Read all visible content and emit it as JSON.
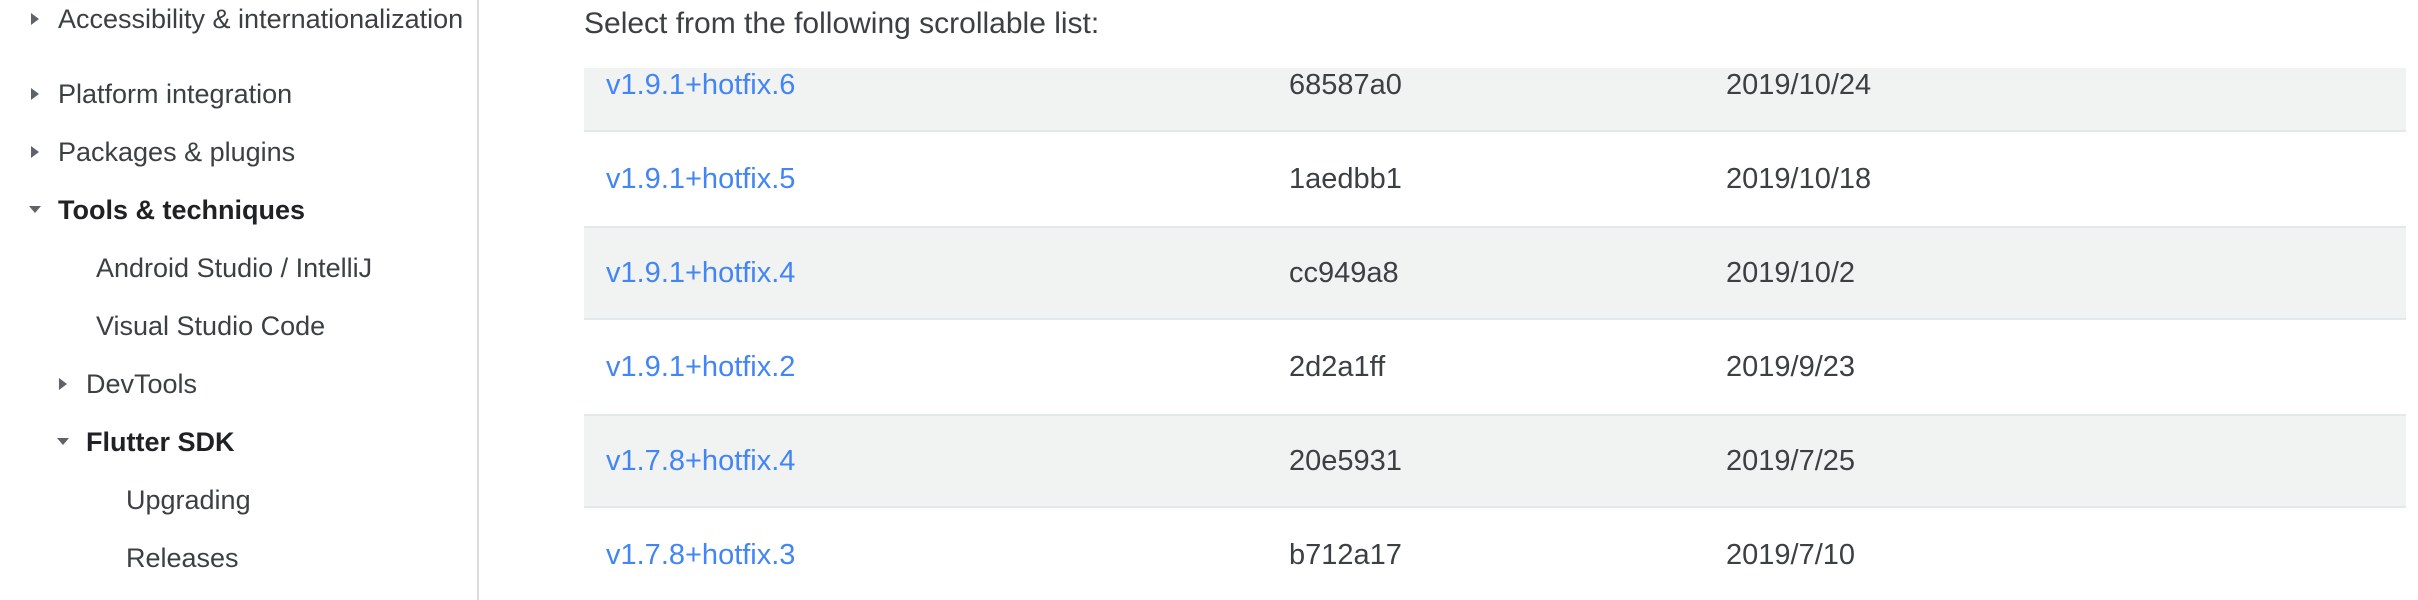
{
  "colors": {
    "link": "#4285f4",
    "text": "#3c4043",
    "heading": "#202124",
    "row_alt_bg": "#f1f2f2",
    "row_border": "#e3e8ea",
    "sidebar_divider": "#dcdcdc"
  },
  "sidebar": {
    "items": [
      {
        "label": "Accessibility & internationalization",
        "level": 1,
        "caret": "collapsed",
        "bold": false,
        "tall": true
      },
      {
        "label": "Platform integration",
        "level": 1,
        "caret": "collapsed",
        "bold": false,
        "tall": false
      },
      {
        "label": "Packages & plugins",
        "level": 1,
        "caret": "collapsed",
        "bold": false,
        "tall": false
      },
      {
        "label": "Tools & techniques",
        "level": 1,
        "caret": "expanded",
        "bold": true,
        "tall": false
      },
      {
        "label": "Android Studio / IntelliJ",
        "level": 2,
        "caret": "none",
        "bold": false,
        "tall": false
      },
      {
        "label": "Visual Studio Code",
        "level": 2,
        "caret": "none",
        "bold": false,
        "tall": false
      },
      {
        "label": "DevTools",
        "level": 2,
        "caret": "collapsed",
        "bold": false,
        "tall": false
      },
      {
        "label": "Flutter SDK",
        "level": 2,
        "caret": "expanded",
        "bold": true,
        "tall": false
      },
      {
        "label": "Upgrading",
        "level": 3,
        "caret": "none",
        "bold": false,
        "tall": false
      },
      {
        "label": "Releases",
        "level": 3,
        "caret": "none",
        "bold": false,
        "tall": false
      }
    ]
  },
  "main": {
    "intro_text": "Select from the following scrollable list:",
    "releases": [
      {
        "version": "v1.9.1+hotfix.6",
        "hash": "68587a0",
        "date": "2019/10/24"
      },
      {
        "version": "v1.9.1+hotfix.5",
        "hash": "1aedbb1",
        "date": "2019/10/18"
      },
      {
        "version": "v1.9.1+hotfix.4",
        "hash": "cc949a8",
        "date": "2019/10/2"
      },
      {
        "version": "v1.9.1+hotfix.2",
        "hash": "2d2a1ff",
        "date": "2019/9/23"
      },
      {
        "version": "v1.7.8+hotfix.4",
        "hash": "20e5931",
        "date": "2019/7/25"
      },
      {
        "version": "v1.7.8+hotfix.3",
        "hash": "b712a17",
        "date": "2019/7/10"
      }
    ]
  }
}
